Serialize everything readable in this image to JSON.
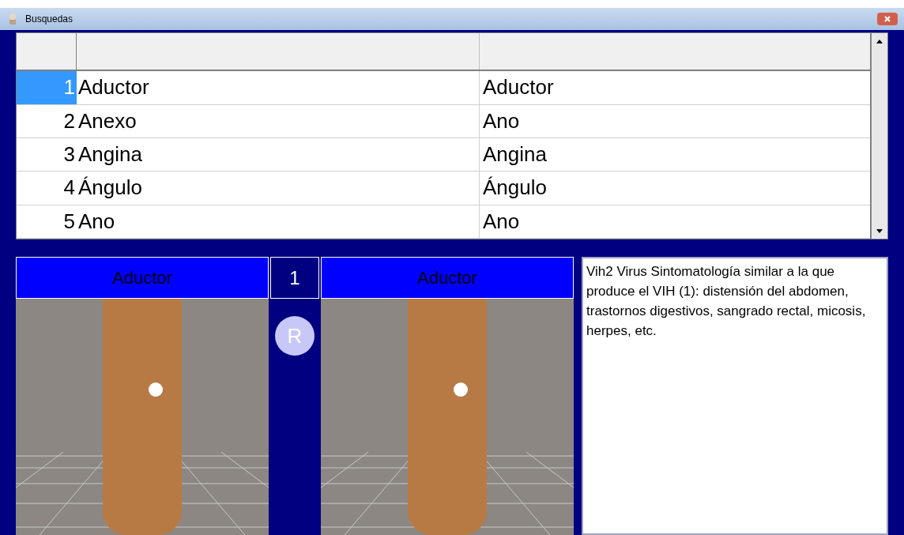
{
  "window": {
    "title": "Busquedas"
  },
  "table": {
    "rows": [
      {
        "number": "1",
        "column_1": "Aductor",
        "column_2": "Aductor",
        "selected": true
      },
      {
        "number": "2",
        "column_1": "Anexo",
        "column_2": "Ano",
        "selected": false
      },
      {
        "number": "3",
        "column_1": "Angina",
        "column_2": "Angina",
        "selected": false
      },
      {
        "number": "4",
        "column_1": "Ángulo",
        "column_2": "Ángulo",
        "selected": false
      },
      {
        "number": "5",
        "column_1": "Ano",
        "column_2": "Ano",
        "selected": false
      }
    ]
  },
  "viewer": {
    "left_title": "Aductor",
    "index": "1",
    "button": "R",
    "right_title": "Aductor"
  },
  "description": "Vih2 Virus Sintomatología similar a la que produce el VIH (1): distensión del abdomen, trastornos digestivos, sangrado rectal, micosis, herpes, etc."
}
